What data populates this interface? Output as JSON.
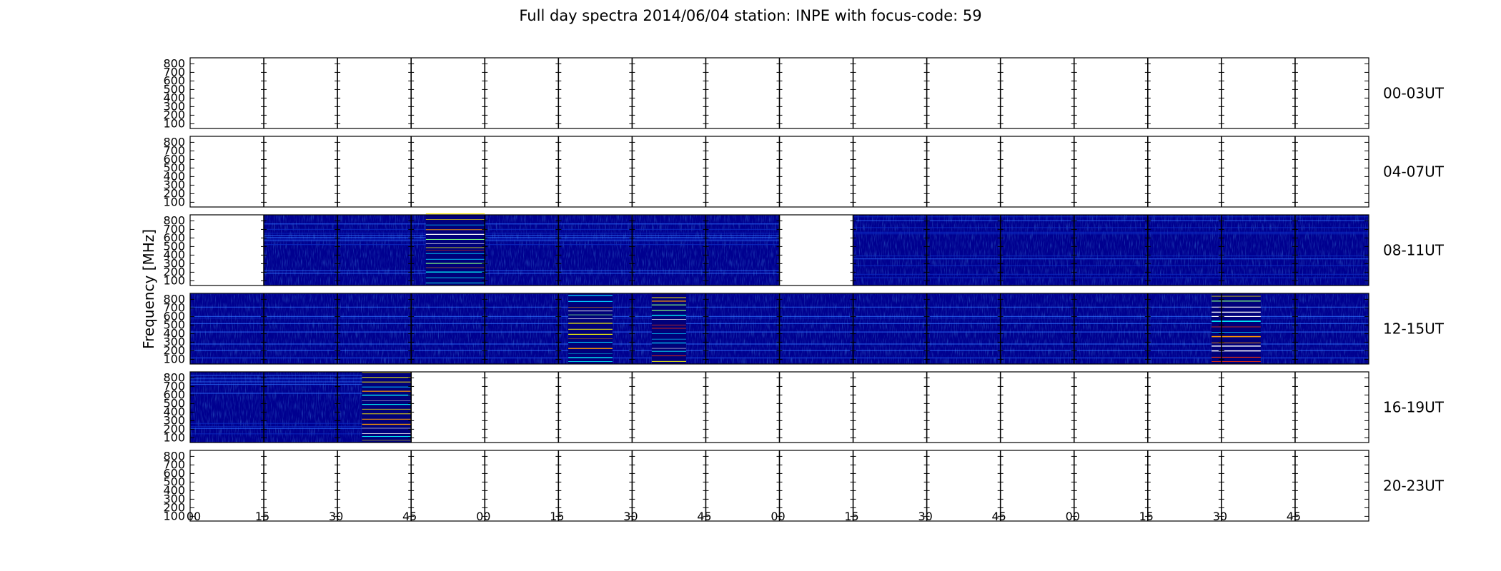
{
  "chart_data": {
    "type": "heatmap",
    "title": "Full day spectra 2014/06/04 station: INPE with focus-code: 59",
    "ylabel": "Frequency [MHz]",
    "xlabel": "",
    "ylim": [
      45,
      870
    ],
    "y_ticks": [
      "100",
      "200",
      "300",
      "400",
      "500",
      "600",
      "700",
      "800"
    ],
    "x_ticks": [
      "00",
      "15",
      "30",
      "45",
      "00",
      "15",
      "30",
      "45",
      "00",
      "15",
      "30",
      "45",
      "00",
      "15",
      "30",
      "45"
    ],
    "rows": [
      {
        "label": "00-03UT",
        "filled_segments": [],
        "bursts": []
      },
      {
        "label": "04-07UT",
        "filled_segments": [],
        "bursts": []
      },
      {
        "label": "08-11UT",
        "filled_segments": [
          [
            15,
            120
          ],
          [
            135,
            240
          ]
        ],
        "bursts": [
          [
            48,
            60
          ]
        ]
      },
      {
        "label": "12-15UT",
        "filled_segments": [
          [
            0,
            240
          ]
        ],
        "bursts": [
          [
            77,
            86
          ],
          [
            94,
            101
          ],
          [
            208,
            218
          ]
        ]
      },
      {
        "label": "16-19UT",
        "filled_segments": [
          [
            0,
            45
          ]
        ],
        "bursts": [
          [
            35,
            45
          ]
        ]
      },
      {
        "label": "20-23UT",
        "filled_segments": [],
        "bursts": []
      }
    ]
  }
}
